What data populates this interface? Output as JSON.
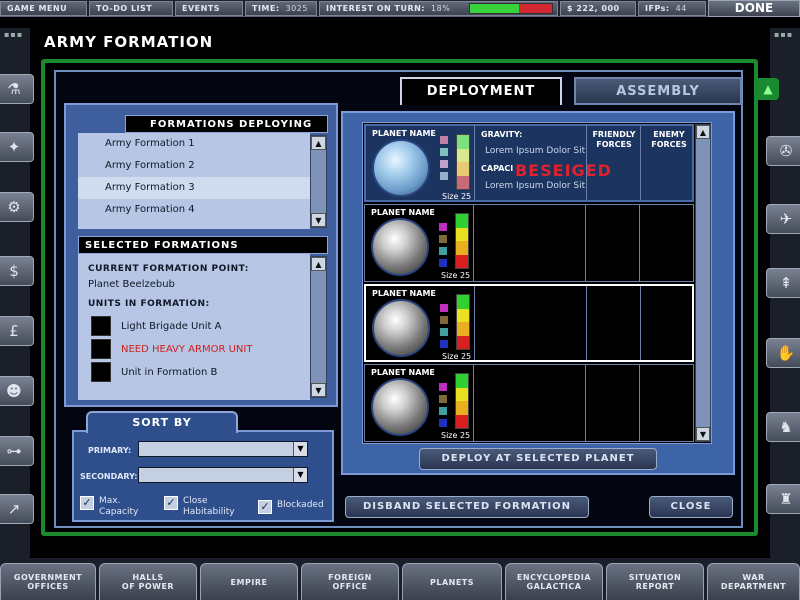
{
  "topbar": {
    "game_menu": "GAME MENU",
    "todo": "TO-DO LIST",
    "events": "EVENTS",
    "time_label": "TIME:",
    "time_value": "3025",
    "interest_label": "INTEREST ON TURN:",
    "interest_value": "18%",
    "interest_fill_percent": 60,
    "money": "$ 222, 000",
    "ifps_label": "IFPs:",
    "ifps_value": "44",
    "done": "DONE"
  },
  "title": "ARMY FORMATION",
  "tabs": {
    "deployment": "DEPLOYMENT",
    "assembly": "ASSEMBLY"
  },
  "formations_deploying": {
    "header": "FORMATIONS DEPLOYING",
    "items": [
      "Army Formation 1",
      "Army Formation 2",
      "Army Formation 3",
      "Army Formation 4"
    ],
    "selected_index": 2
  },
  "selected_formations": {
    "header": "SELECTED FORMATIONS",
    "point_label": "CURRENT FORMATION POINT:",
    "point_value": "Planet Beelzebub",
    "units_label": "UNITS IN FORMATION:",
    "units": [
      "Light Brigade Unit A",
      "NEED HEAVY ARMOR UNIT",
      "Unit in Formation B"
    ]
  },
  "sort_by": {
    "header": "SORT BY",
    "primary_label": "PRIMARY:",
    "secondary_label": "SECONDARY:",
    "checkboxes": [
      {
        "label_1": "Max.",
        "label_2": "Capacity",
        "checked": true
      },
      {
        "label_1": "Close",
        "label_2": "Habitability",
        "checked": true
      },
      {
        "label_1": "Blockaded",
        "label_2": "",
        "checked": true
      }
    ],
    "check_glyph": "✓"
  },
  "planets": {
    "name_label": "PLANET NAME",
    "size_label": "Size 25",
    "gravity_label": "GRAVITY:",
    "capacity_label": "CAPACI",
    "lorem_1": "Lorem Ipsum Dolor Sit",
    "lorem_2": "Lorem Ipsum Dolor Sit",
    "status": "BESEIGED",
    "friendly_1": "FRIENDLY",
    "friendly_2": "FORCES",
    "enemy_1": "ENEMY",
    "enemy_2": "FORCES"
  },
  "buttons": {
    "deploy": "DEPLOY AT SELECTED PLANET",
    "disband": "DISBAND SELECTED FORMATION",
    "close": "CLOSE"
  },
  "bottom_nav": [
    {
      "l1": "GOVERNMENT",
      "l2": "OFFICES"
    },
    {
      "l1": "HALLS",
      "l2": "OF POWER"
    },
    {
      "l1": "EMPIRE",
      "l2": ""
    },
    {
      "l1": "FOREIGN",
      "l2": "OFFICE"
    },
    {
      "l1": "PLANETS",
      "l2": ""
    },
    {
      "l1": "ENCYCLOPEDIA",
      "l2": "GALACTICA"
    },
    {
      "l1": "SITUATION",
      "l2": "REPORT"
    },
    {
      "l1": "WAR",
      "l2": "DEPARTMENT"
    }
  ],
  "glyphs": {
    "scroll_up": "▲",
    "scroll_down": "▼",
    "dropdown_arrow": "▼",
    "grip": "▪▪▪"
  },
  "icons": {
    "left_rail": [
      "flask-icon",
      "globe-icon",
      "gear-icon",
      "dollar-icon",
      "pound-icon",
      "group-icon",
      "network-icon",
      "chart-icon"
    ],
    "right_rail": [
      "wrench-icon",
      "plane-icon",
      "fighter-icon",
      "hand-icon",
      "soldier-icon",
      "tower-icon"
    ]
  },
  "colors": {
    "frame_green": "#1a8a30",
    "panel_blue": "#3e64a8",
    "besieged_red": "#e0222c",
    "warning_red": "#d02020"
  }
}
